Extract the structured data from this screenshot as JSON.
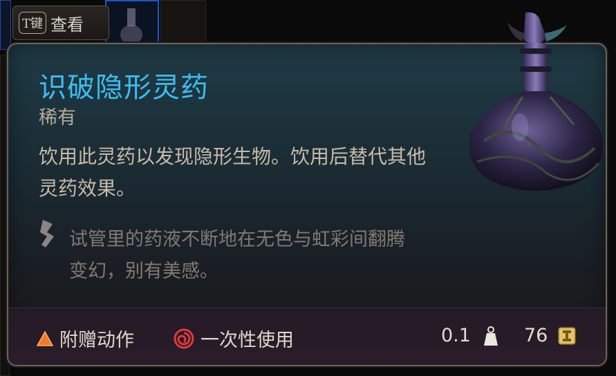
{
  "hint": {
    "key": "T键",
    "label": "查看"
  },
  "item": {
    "name": "识破隐形灵药",
    "rarity": "稀有",
    "description": "饮用此灵药以发现隐形生物。饮用后替代其他灵药效果。",
    "flavor": "试管里的药液不断地在无色与虹彩间翻腾变幻，别有美感。"
  },
  "footer": {
    "bonus_action": "附赠动作",
    "single_use": "一次性使用",
    "weight": "0.1",
    "value": "76"
  },
  "icons": {
    "bonus_action": "orange-triangle-icon",
    "single_use": "red-spiral-icon",
    "weight": "weight-icon",
    "value": "gold-coin-icon",
    "flavor": "quill-icon"
  },
  "colors": {
    "title": "#3dbdf2",
    "rarity": "#b5aa9c",
    "description": "#c8bba9",
    "flavor": "#827a70",
    "accent_orange": "#f07a2a",
    "accent_red": "#e03a3a",
    "gold": "#e4c46a"
  }
}
